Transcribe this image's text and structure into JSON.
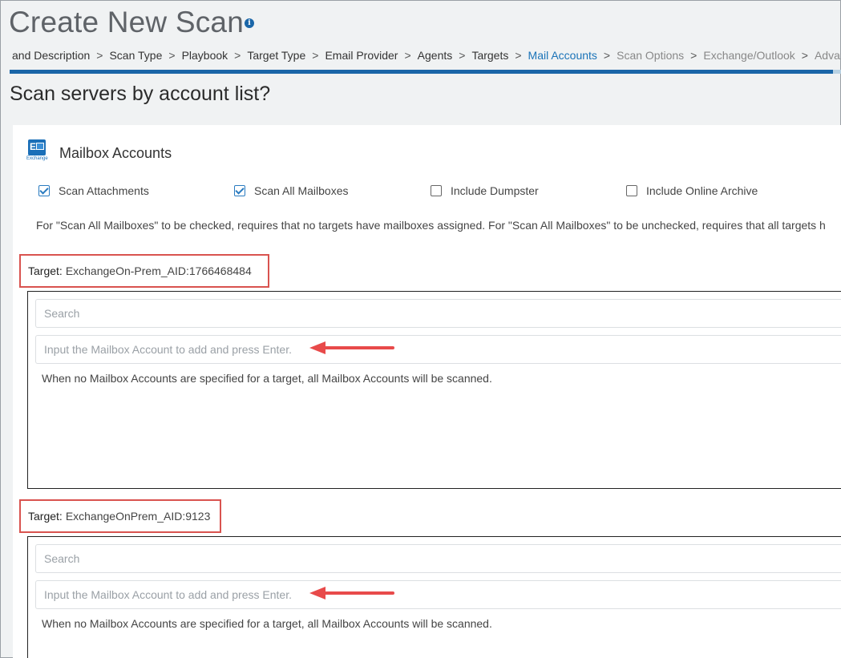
{
  "page": {
    "title": "Create New Scan",
    "info_icon": "info-icon",
    "section_heading": "Scan servers by account list?"
  },
  "wizard": {
    "steps": [
      {
        "label": "and Description",
        "state": "done"
      },
      {
        "label": "Scan Type",
        "state": "done"
      },
      {
        "label": "Playbook",
        "state": "done"
      },
      {
        "label": "Target Type",
        "state": "done"
      },
      {
        "label": "Email Provider",
        "state": "done"
      },
      {
        "label": "Agents",
        "state": "done"
      },
      {
        "label": "Targets",
        "state": "done"
      },
      {
        "label": "Mail Accounts",
        "state": "active"
      },
      {
        "label": "Scan Options",
        "state": "future"
      },
      {
        "label": "Exchange/Outlook",
        "state": "future"
      },
      {
        "label": "Advan",
        "state": "future"
      }
    ],
    "separator": ">",
    "progress_fraction": 0.99,
    "colors": {
      "active": "#1a73b8",
      "progress": "#1a66a8",
      "track": "#b9d2e3"
    }
  },
  "mailbox": {
    "icon": "exchange-icon",
    "icon_caption": "Exchange",
    "title": "Mailbox Accounts",
    "options": [
      {
        "label": "Scan Attachments",
        "checked": true
      },
      {
        "label": "Scan All Mailboxes",
        "checked": true
      },
      {
        "label": "Include Dumpster",
        "checked": false
      },
      {
        "label": "Include Online Archive",
        "checked": false
      }
    ],
    "note": "For \"Scan All Mailboxes\" to be checked, requires that no targets have mailboxes assigned. For \"Scan All Mailboxes\" to be unchecked, requires that all targets h"
  },
  "targets": [
    {
      "label_key": "Target:",
      "label_value": "ExchangeOn-Prem_AID:1766468484",
      "search_placeholder": "Search",
      "input_placeholder": "Input the Mailbox Account to add and press Enter.",
      "hint": "When no Mailbox Accounts are specified for a target, all Mailbox Accounts will be scanned."
    },
    {
      "label_key": "Target:",
      "label_value": "ExchangeOnPrem_AID:9123",
      "search_placeholder": "Search",
      "input_placeholder": "Input the Mailbox Account to add and press Enter.",
      "hint": "When no Mailbox Accounts are specified for a target, all Mailbox Accounts will be scanned."
    }
  ],
  "annotation": {
    "highlight_color": "#d9534f",
    "arrow_color": "#e84a4a"
  }
}
